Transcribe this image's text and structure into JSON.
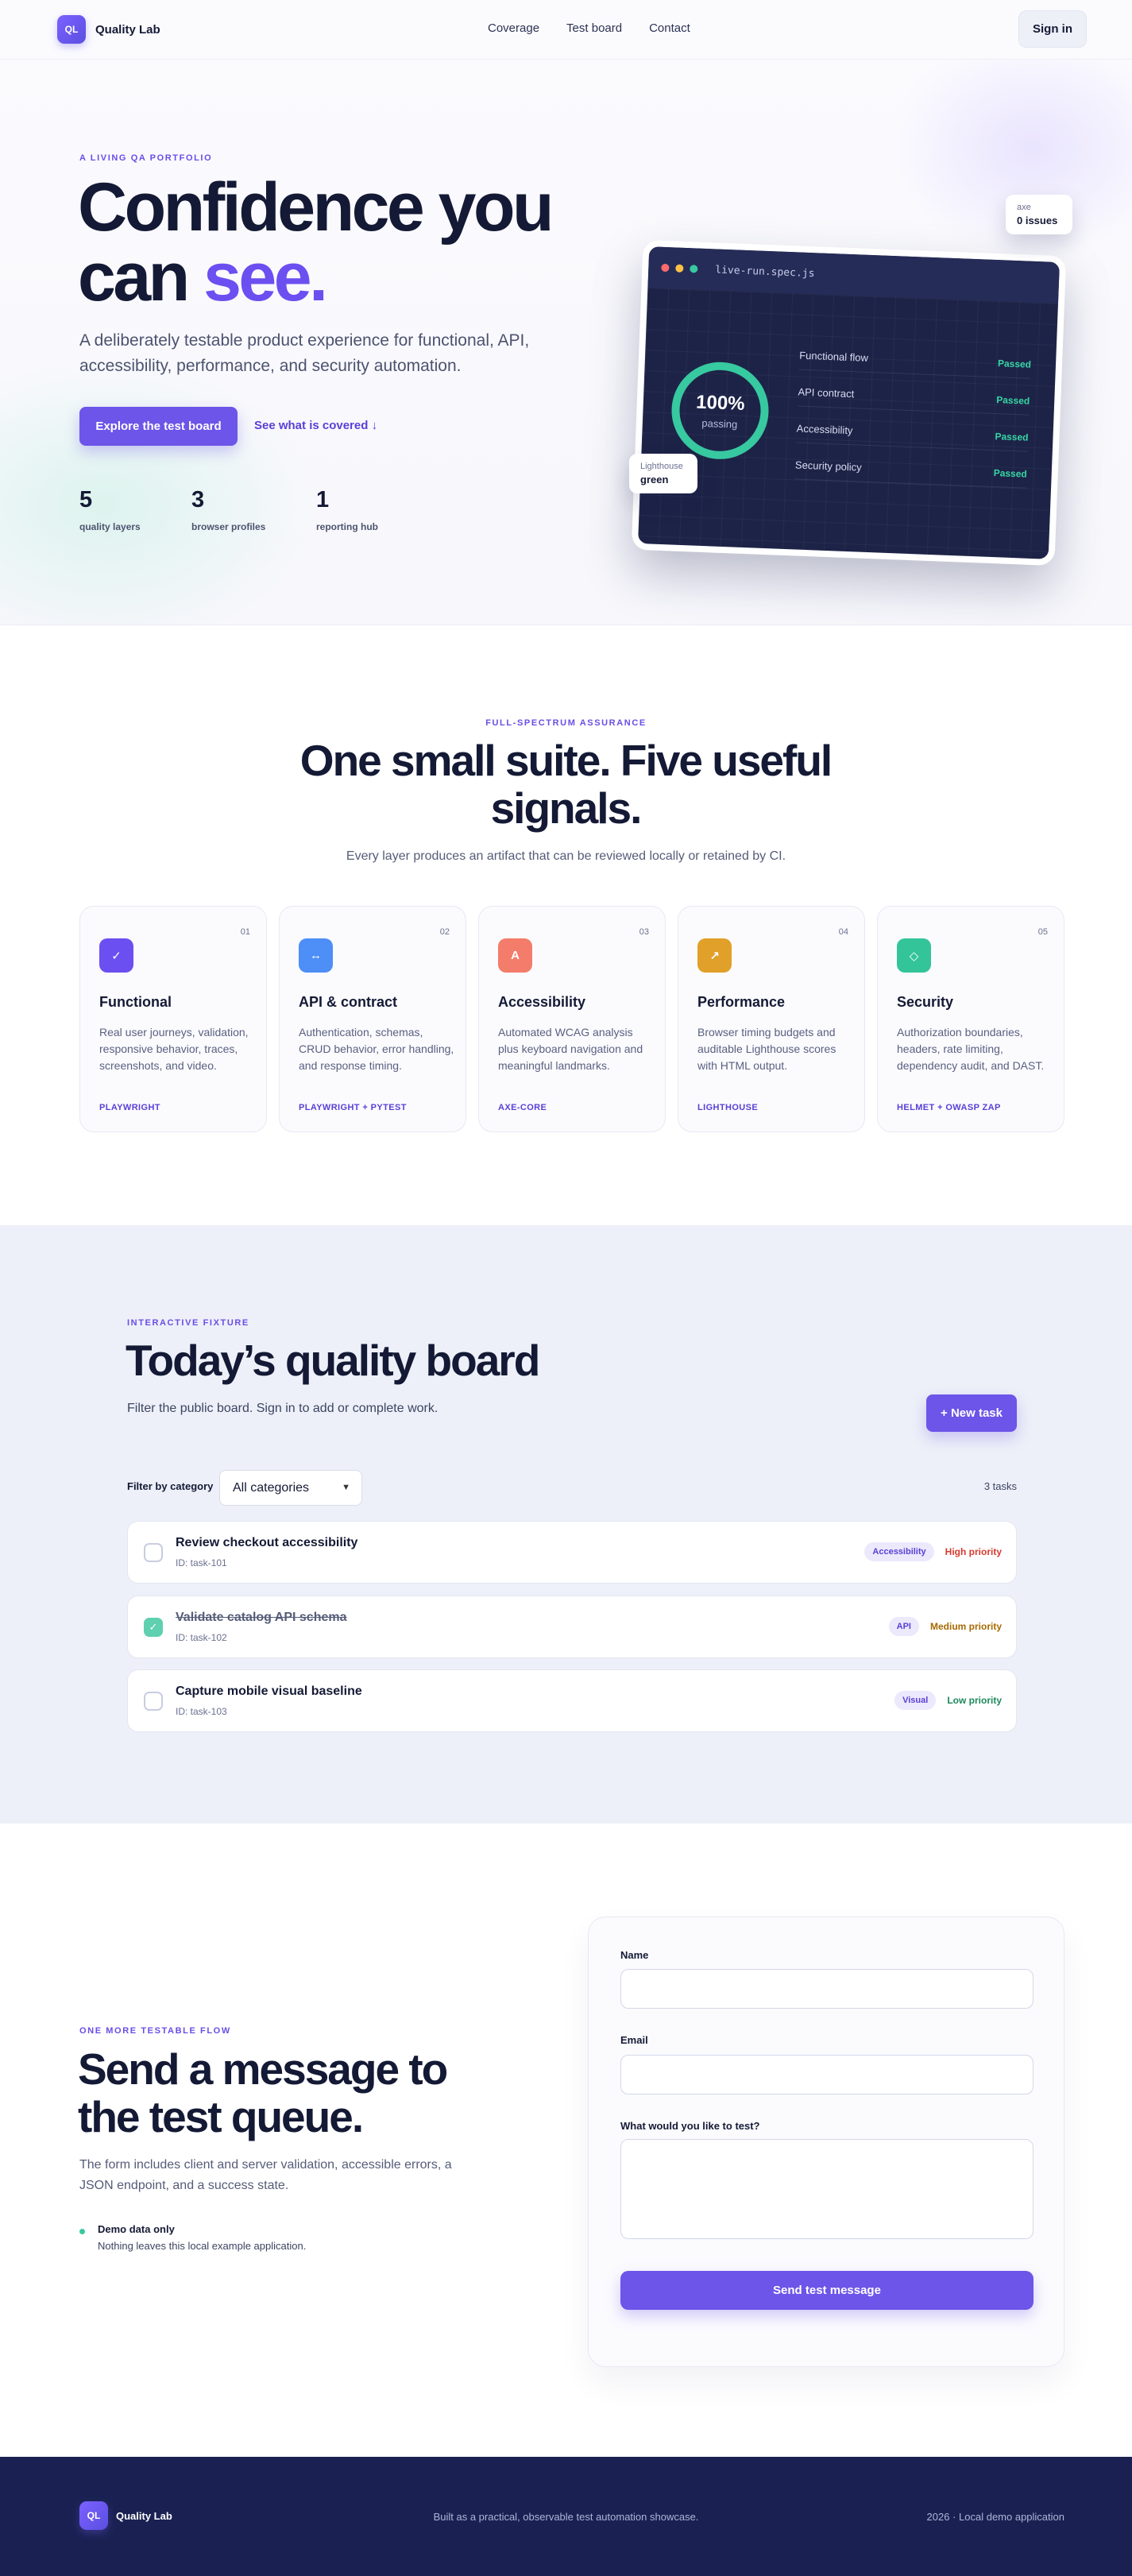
{
  "nav": {
    "brand_badge": "QL",
    "brand_name": "Quality Lab",
    "links": [
      "Coverage",
      "Test board",
      "Contact"
    ],
    "signin": "Sign in"
  },
  "hero": {
    "eyebrow": "A LIVING QA PORTFOLIO",
    "title_line1": "Confidence you",
    "title_line2a": "can ",
    "title_line2b": "see.",
    "subtitle": "A deliberately testable product experience for functional, API, accessibility, performance, and security automation.",
    "cta_primary": "Explore the test board",
    "cta_secondary": "See what is covered ↓",
    "stats": [
      {
        "value": "5",
        "label": "quality layers"
      },
      {
        "value": "3",
        "label": "browser profiles"
      },
      {
        "value": "1",
        "label": "reporting hub"
      }
    ],
    "device": {
      "file": "live-run.spec.js",
      "ring_value": "100%",
      "ring_label": "passing",
      "checks": [
        {
          "name": "Functional flow",
          "status": "Passed"
        },
        {
          "name": "API contract",
          "status": "Passed"
        },
        {
          "name": "Accessibility",
          "status": "Passed"
        },
        {
          "name": "Security policy",
          "status": "Passed"
        }
      ],
      "dot_colors": [
        "#ff6b6b",
        "#ffc048",
        "#37c9a0"
      ]
    },
    "axe_card": {
      "label": "axe",
      "value": "0 issues"
    },
    "lighthouse_card": {
      "label": "Lighthouse",
      "value": "green"
    }
  },
  "suite": {
    "eyebrow": "FULL-SPECTRUM ASSURANCE",
    "title": "One small suite. Five useful signals.",
    "subtitle": "Every layer produces an artifact that can be reviewed locally or retained by CI.",
    "cards": [
      {
        "num": "01",
        "icon": "✓",
        "icon_name": "check-icon",
        "color": "#6c4ff0",
        "title": "Functional",
        "desc": "Real user journeys, validation, responsive behavior, traces, screenshots, and video.",
        "tag": "PLAYWRIGHT"
      },
      {
        "num": "02",
        "icon": "↔",
        "icon_name": "arrows-icon",
        "color": "#4d8ef7",
        "title": "API & contract",
        "desc": "Authentication, schemas, CRUD behavior, error handling, and response timing.",
        "tag": "PLAYWRIGHT + PYTEST"
      },
      {
        "num": "03",
        "icon": "A",
        "icon_name": "letter-a-icon",
        "color": "#f37c6a",
        "title": "Accessibility",
        "desc": "Automated WCAG analysis plus keyboard navigation and meaningful landmarks.",
        "tag": "AXE-CORE"
      },
      {
        "num": "04",
        "icon": "↗",
        "icon_name": "trend-up-icon",
        "color": "#e0a02a",
        "title": "Performance",
        "desc": "Browser timing budgets and auditable Lighthouse scores with HTML output.",
        "tag": "LIGHTHOUSE"
      },
      {
        "num": "05",
        "icon": "◇",
        "icon_name": "shield-diamond-icon",
        "color": "#33c49a",
        "title": "Security",
        "desc": "Authorization boundaries, headers, rate limiting, dependency audit, and DAST.",
        "tag": "HELMET + OWASP ZAP"
      }
    ]
  },
  "board": {
    "eyebrow": "INTERACTIVE FIXTURE",
    "title": "Today’s quality board",
    "subtitle": "Filter the public board. Sign in to add or complete work.",
    "new_task": "+ New task",
    "filter_label": "Filter by category",
    "filter_value": "All categories",
    "task_count": "3 tasks",
    "tasks": [
      {
        "title": "Review checkout accessibility",
        "id": "ID: task-101",
        "category": "Accessibility",
        "priority": "High priority",
        "priority_color": "#d63a2f",
        "done": false
      },
      {
        "title": "Validate catalog API schema",
        "id": "ID: task-102",
        "category": "API",
        "priority": "Medium priority",
        "priority_color": "#a76a00",
        "done": true
      },
      {
        "title": "Capture mobile visual baseline",
        "id": "ID: task-103",
        "category": "Visual",
        "priority": "Low priority",
        "priority_color": "#1d8a5c",
        "done": false
      }
    ]
  },
  "contact": {
    "eyebrow": "ONE MORE TESTABLE FLOW",
    "title": "Send a message to the test queue.",
    "desc": "The form includes client and server validation, accessible errors, a JSON endpoint, and a success state.",
    "note_title": "Demo data only",
    "note_text": "Nothing leaves this local example application.",
    "form": {
      "name_label": "Name",
      "email_label": "Email",
      "message_label": "What would you like to test?",
      "submit": "Send test message"
    }
  },
  "footer": {
    "brand_badge": "QL",
    "brand_name": "Quality Lab",
    "middle": "Built as a practical, observable test automation showcase.",
    "right": "2026 · Local demo application"
  }
}
